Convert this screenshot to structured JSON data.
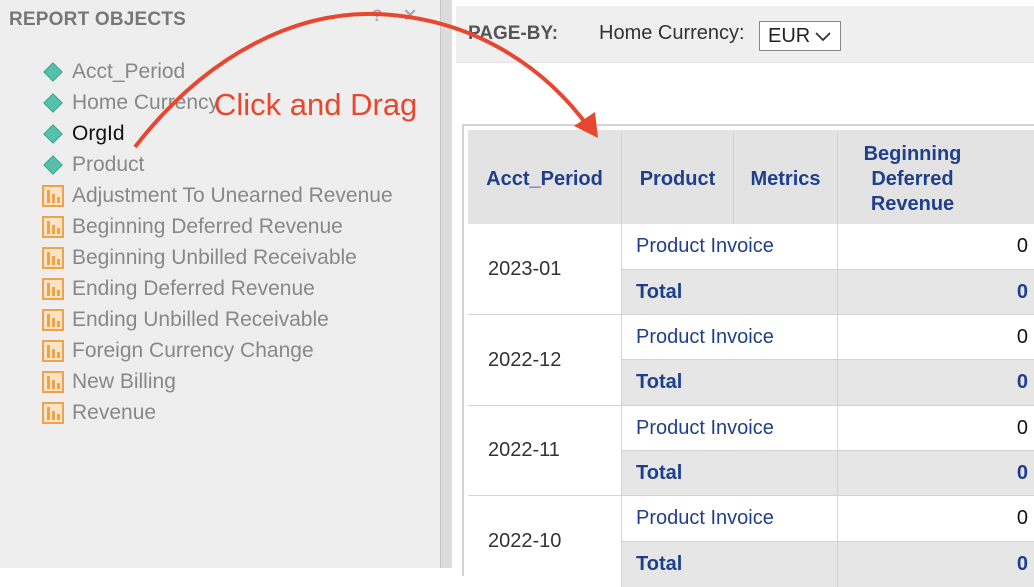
{
  "left_panel": {
    "title": "REPORT OBJECTS",
    "help_glyph": "?",
    "close_glyph": "✕",
    "items": [
      {
        "label": "Acct_Period",
        "kind": "attribute"
      },
      {
        "label": "Home Currency",
        "kind": "attribute"
      },
      {
        "label": "OrgId",
        "kind": "attribute"
      },
      {
        "label": "Product",
        "kind": "attribute"
      },
      {
        "label": "Adjustment To Unearned Revenue",
        "kind": "metric"
      },
      {
        "label": "Beginning Deferred Revenue",
        "kind": "metric"
      },
      {
        "label": "Beginning Unbilled Receivable",
        "kind": "metric"
      },
      {
        "label": "Ending Deferred Revenue",
        "kind": "metric"
      },
      {
        "label": "Ending Unbilled Receivable",
        "kind": "metric"
      },
      {
        "label": "Foreign Currency Change",
        "kind": "metric"
      },
      {
        "label": "New Billing",
        "kind": "metric"
      },
      {
        "label": "Revenue",
        "kind": "metric"
      }
    ]
  },
  "page_by": {
    "label": "PAGE-BY:",
    "currency_label": "Home Currency:",
    "currency_value": "EUR"
  },
  "grid": {
    "headers": [
      "Acct_Period",
      "Product",
      "Metrics",
      "Beginning Deferred Revenue"
    ],
    "rows": [
      {
        "period": "2023-01",
        "product": "Product Invoice",
        "value": "0",
        "total_label": "Total",
        "total_value": "0"
      },
      {
        "period": "2022-12",
        "product": "Product Invoice",
        "value": "0",
        "total_label": "Total",
        "total_value": "0"
      },
      {
        "period": "2022-11",
        "product": "Product Invoice",
        "value": "0",
        "total_label": "Total",
        "total_value": "0"
      },
      {
        "period": "2022-10",
        "product": "Product Invoice",
        "value": "0",
        "total_label": "Total",
        "total_value": "0"
      }
    ]
  },
  "annotation": {
    "text": "Click and Drag",
    "color": "#e8472f"
  },
  "colors": {
    "header_text": "#1f3f8c",
    "attribute_icon": "#56c1ab",
    "metric_icon": "#f0a24b"
  }
}
